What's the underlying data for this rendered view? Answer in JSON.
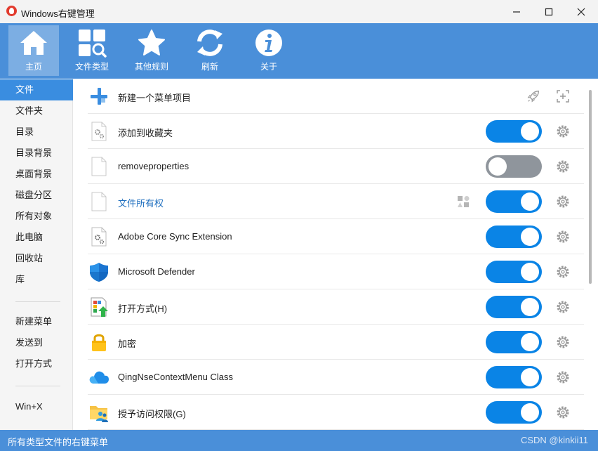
{
  "window": {
    "title": "Windows右键管理"
  },
  "toolbar": {
    "buttons": [
      {
        "label": "主页",
        "icon": "home-icon",
        "active": true
      },
      {
        "label": "文件类型",
        "icon": "file-types-icon",
        "active": false
      },
      {
        "label": "其他规则",
        "icon": "star-icon",
        "active": false
      },
      {
        "label": "刷新",
        "icon": "refresh-icon",
        "active": false
      },
      {
        "label": "关于",
        "icon": "info-icon",
        "active": false
      }
    ]
  },
  "sidebar": {
    "items": [
      {
        "label": "文件",
        "active": true
      },
      {
        "label": "文件夹"
      },
      {
        "label": "目录"
      },
      {
        "label": "目录背景"
      },
      {
        "label": "桌面背景"
      },
      {
        "label": "磁盘分区"
      },
      {
        "label": "所有对象"
      },
      {
        "label": "此电脑"
      },
      {
        "label": "回收站"
      },
      {
        "label": "库"
      },
      {
        "label": "新建菜单"
      },
      {
        "label": "发送到"
      },
      {
        "label": "打开方式"
      },
      {
        "label": "Win+X"
      }
    ]
  },
  "list": {
    "new_item": {
      "label": "新建一个菜单项目",
      "icon": "add-cross-icon"
    },
    "items": [
      {
        "label": "添加到收藏夹",
        "enabled": true,
        "icon": "file-gear-icon"
      },
      {
        "label": "removeproperties",
        "enabled": false,
        "icon": "blank-file-icon"
      },
      {
        "label": "文件所有权",
        "enabled": true,
        "icon": "blank-file-icon",
        "highlight": true
      },
      {
        "label": "Adobe Core Sync Extension",
        "enabled": true,
        "icon": "file-gear-icon"
      },
      {
        "label": "Microsoft Defender",
        "enabled": true,
        "icon": "defender-shield-icon"
      },
      {
        "label": "打开方式(H)",
        "enabled": true,
        "icon": "open-with-icon"
      },
      {
        "label": "加密",
        "enabled": true,
        "icon": "lock-icon"
      },
      {
        "label": "QingNseContextMenu Class",
        "enabled": true,
        "icon": "cloud-icon"
      },
      {
        "label": "授予访问权限(G)",
        "enabled": true,
        "icon": "folder-users-icon"
      }
    ]
  },
  "statusbar": {
    "text": "所有类型文件的右键菜单",
    "watermark": "CSDN @kinkii11"
  },
  "colors": {
    "accent": "#4a8fd9",
    "toggle_on": "#0a84e6",
    "toggle_off": "#8f959c",
    "selected": "#3a8de0"
  }
}
